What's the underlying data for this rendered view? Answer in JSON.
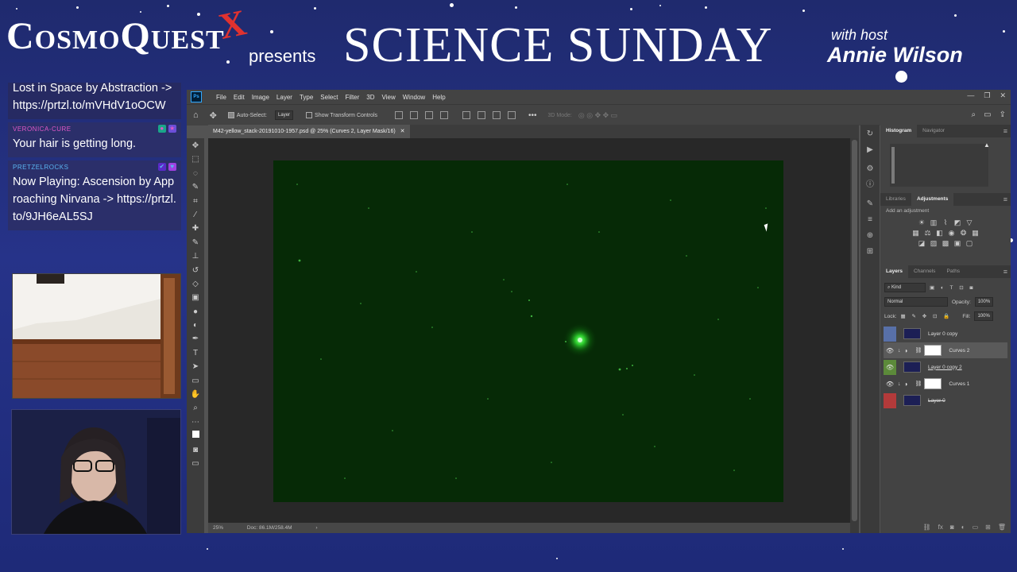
{
  "stream": {
    "logo": "CosmoQuest",
    "logo_x": "X",
    "presents": "presents",
    "title": "SCIENCE SUNDAY",
    "with_host": "with host",
    "host_name": "Annie Wilson"
  },
  "chat": [
    {
      "user": "",
      "text": "Lost in Space by Abstraction -> https://prtzl.to/mVHdV1oOCW"
    },
    {
      "user": "VERONICA-CURE",
      "user_color": "#e058c8",
      "text": "Your hair is getting long."
    },
    {
      "user": "PRETZELROCKS",
      "user_color": "#5ab4f0",
      "text": "Now Playing: Ascension by Approaching Nirvana -> https://prtzl.to/9JH6eAL5SJ"
    }
  ],
  "photoshop": {
    "menu": [
      "File",
      "Edit",
      "Image",
      "Layer",
      "Type",
      "Select",
      "Filter",
      "3D",
      "View",
      "Window",
      "Help"
    ],
    "options": {
      "auto_select_label": "Auto-Select:",
      "auto_select_value": "Layer",
      "transform_label": "Show Transform Controls",
      "mode_3d": "3D Mode:"
    },
    "document_tab": "M42-yellow_stack-20191010-1957.psd @ 25% (Curves 2, Layer Mask/16)",
    "status": {
      "zoom": "25%",
      "doc": "Doc: 86.1M/258.4M"
    },
    "panels": {
      "top_tabs": [
        "Histogram",
        "Navigator"
      ],
      "mid_tabs": [
        "Libraries",
        "Adjustments"
      ],
      "add_adjustment": "Add an adjustment",
      "layer_tabs": [
        "Layers",
        "Channels",
        "Paths"
      ],
      "kind": "Kind",
      "blend_mode": "Normal",
      "opacity_label": "Opacity:",
      "opacity_value": "100%",
      "lock_label": "Lock:",
      "fill_label": "Fill:",
      "fill_value": "100%"
    },
    "layers": [
      {
        "name": "Layer 0 copy",
        "tag": "blue"
      },
      {
        "name": "Curves 2",
        "tag": "none"
      },
      {
        "name": "Layer 0 copy 2",
        "tag": "green"
      },
      {
        "name": "Curves 1",
        "tag": "none"
      },
      {
        "name": "Layer 0",
        "tag": "red"
      }
    ]
  }
}
